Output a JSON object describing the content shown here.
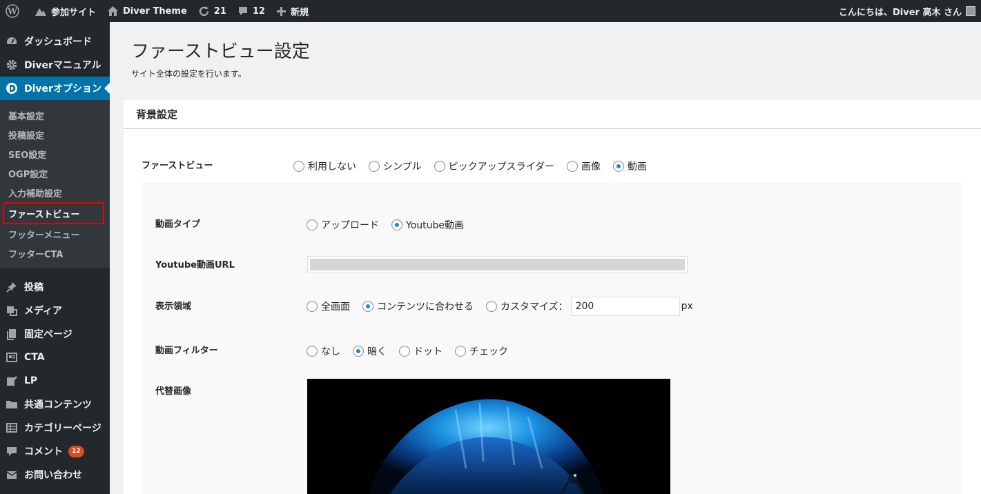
{
  "adminbar": {
    "site_name": "参加サイト",
    "theme_name": "Diver Theme",
    "updates_count": "21",
    "comments_count": "12",
    "new_label": "新規",
    "greeting": "こんにちは、Diver 高木 さん"
  },
  "sidebar": {
    "top_items": [
      {
        "label": "ダッシュボード",
        "icon": "dashboard-icon"
      },
      {
        "label": "Diverマニュアル",
        "icon": "gear-icon"
      },
      {
        "label": "Diverオプション",
        "icon": "diver-logo-icon"
      }
    ],
    "submenu": [
      "基本設定",
      "投稿設定",
      "SEO設定",
      "OGP設定",
      "入力補助設定",
      "ファーストビュー",
      "フッターメニュー",
      "フッターCTA"
    ],
    "bottom_items": [
      {
        "label": "投稿",
        "icon": "pin-icon"
      },
      {
        "label": "メディア",
        "icon": "media-icon"
      },
      {
        "label": "固定ページ",
        "icon": "page-icon"
      },
      {
        "label": "CTA",
        "icon": "cta-icon"
      },
      {
        "label": "LP",
        "icon": "edit-icon"
      },
      {
        "label": "共通コンテンツ",
        "icon": "folder-icon"
      },
      {
        "label": "カテゴリーページ",
        "icon": "grid-icon"
      },
      {
        "label": "コメント",
        "icon": "comment-icon",
        "badge": "12"
      },
      {
        "label": "お問い合わせ",
        "icon": "mail-icon"
      }
    ]
  },
  "main": {
    "title": "ファーストビュー設定",
    "description": "サイト全体の設定を行います。",
    "section_title": "背景設定",
    "firstview": {
      "label": "ファーストビュー",
      "options": [
        "利用しない",
        "シンプル",
        "ピックアップスライダー",
        "画像",
        "動画"
      ],
      "selected": "動画"
    },
    "video_type": {
      "label": "動画タイプ",
      "options": [
        "アップロード",
        "Youtube動画"
      ],
      "selected": "Youtube動画"
    },
    "youtube_url": {
      "label": "Youtube動画URL"
    },
    "display_area": {
      "label": "表示領域",
      "options": [
        "全画面",
        "コンテンツに合わせる",
        "カスタマイズ："
      ],
      "selected": "コンテンツに合わせる",
      "custom_value": "200",
      "unit": "px"
    },
    "video_filter": {
      "label": "動画フィルター",
      "options": [
        "なし",
        "暗く",
        "ドット",
        "チェック"
      ],
      "selected": "暗く"
    },
    "fallback_image": {
      "label": "代替画像"
    }
  }
}
